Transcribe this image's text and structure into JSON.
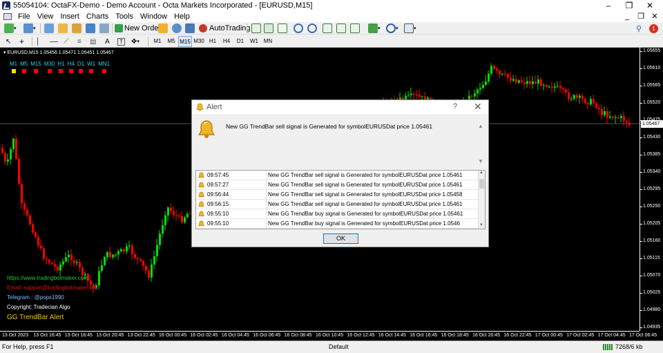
{
  "window": {
    "title": "55054104: OctaFX-Demo - Demo Account - Octa Markets Incorporated - [EURUSD,M15]",
    "minimize": "–",
    "restore": "❐",
    "close": "✕"
  },
  "menu": [
    "File",
    "View",
    "Insert",
    "Charts",
    "Tools",
    "Window",
    "Help"
  ],
  "mdi_controls": {
    "minimize": "_",
    "restore": "❐",
    "close": "✕"
  },
  "toolbar": {
    "new_order": "New Order",
    "autotrading": "AutoTrading",
    "notification_count": "1"
  },
  "timeframes": [
    "M1",
    "M5",
    "M15",
    "M30",
    "H1",
    "H4",
    "D1",
    "W1",
    "MN"
  ],
  "active_timeframe": "M15",
  "chart": {
    "symbol_info": "EURUSD,M15  1.05456 1.05471 1.05451 1.05467",
    "current_price": "1.05467",
    "price_labels": [
      "1.05655",
      "1.05610",
      "1.05565",
      "1.05520",
      "1.05475",
      "1.05430",
      "1.05385",
      "1.05340",
      "1.05295",
      "1.05250",
      "1.05205",
      "1.05160",
      "1.05115",
      "1.05070",
      "1.05025",
      "1.04980",
      "1.04935"
    ],
    "time_labels": [
      "13 Oct 2023",
      "13 Oct 16:45",
      "13 Oct 18:45",
      "13 Oct 20:45",
      "13 Oct 22:45",
      "16 Oct 00:45",
      "16 Oct 02:45",
      "16 Oct 04:45",
      "16 Oct 06:45",
      "16 Oct 08:45",
      "16 Oct 10:45",
      "16 Oct 12:45",
      "16 Oct 14:45",
      "16 Oct 16:45",
      "16 Oct 18:45",
      "16 Oct 20:45",
      "16 Oct 22:45",
      "17 Oct 00:45",
      "17 Oct 02:45",
      "17 Oct 04:45",
      "17 Oct 06:45"
    ],
    "indicator_tfs": [
      {
        "label": "M1",
        "color": "#ffe000"
      },
      {
        "label": "M5",
        "color": "#ff0000"
      },
      {
        "label": "M15",
        "color": "#ff0000"
      },
      {
        "label": "M30",
        "color": "#ff0000"
      },
      {
        "label": "H1",
        "color": "#ff0000"
      },
      {
        "label": "H4",
        "color": "#ff0000"
      },
      {
        "label": "D1",
        "color": "#ff0000"
      },
      {
        "label": "W1",
        "color": "#ff0000"
      },
      {
        "label": "MN1",
        "color": "#ff0000"
      }
    ],
    "website": "https://www.tradingbotmaker.com",
    "email": "Email: support@tradingbotmaker.com",
    "telegram": "Telegram : @pops1990",
    "copyright": "Copyright: Tradecian Algo",
    "indicator_name": "GG TrendBar Alert",
    "bull_color": "#00e000",
    "bear_color": "#ff0000"
  },
  "alert": {
    "title": "Alert",
    "help": "?",
    "close": "✕",
    "message": "New GG TrendBar sell signal is Generated for symbolEURUSDat price 1.05461",
    "rows": [
      {
        "time": "09:57:45",
        "text": "New GG TrendBar sell signal is Generated for symbolEURUSDat price 1.05461"
      },
      {
        "time": "09:57:27",
        "text": "New GG TrendBar sell signal is Generated for symbolEURUSDat price 1.05461"
      },
      {
        "time": "09:56:44",
        "text": "New GG TrendBar sell signal is Generated for symbolEURUSDat price 1.05458"
      },
      {
        "time": "09:56:15",
        "text": "New GG TrendBar sell signal is Generated for symbolEURUSDat price 1.05461"
      },
      {
        "time": "09:55:10",
        "text": "New GG TrendBar buy signal is Generated for symbolEURUSDat price 1.05461"
      },
      {
        "time": "09:55:10",
        "text": "New GG TrendBar buy signal is Generated for symbolEURUSDat price 1.0546"
      }
    ],
    "ok": "OK"
  },
  "statusbar": {
    "help": "For Help, press F1",
    "profile": "Default",
    "traffic": "7268/6 kb"
  }
}
